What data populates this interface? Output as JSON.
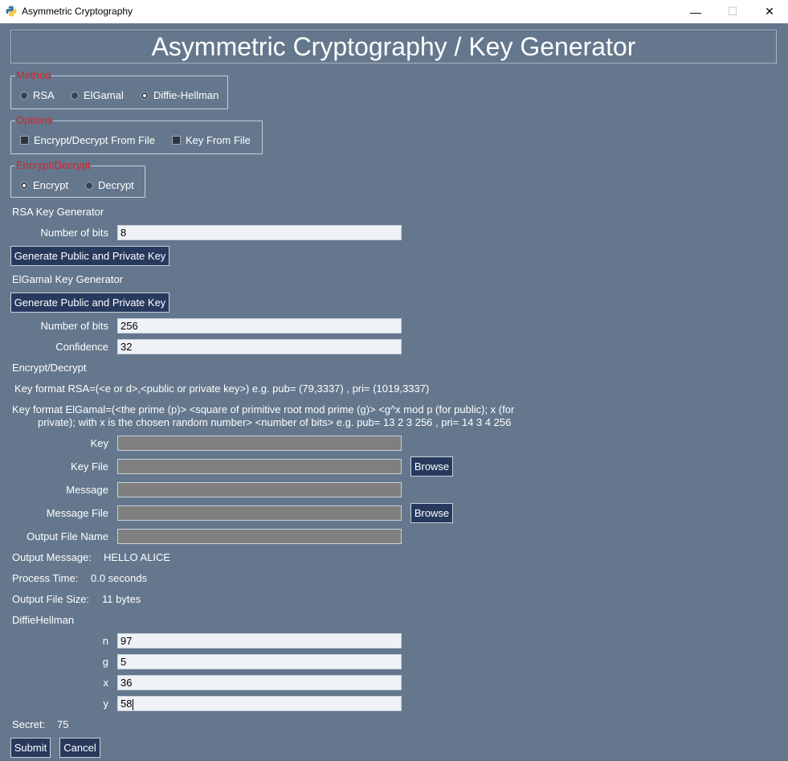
{
  "window": {
    "title": "Asymmetric Cryptography",
    "controls": {
      "minimize": "—",
      "maximize": "☐",
      "close": "✕"
    }
  },
  "header": {
    "title": "Asymmetric Cryptography / Key Generator"
  },
  "method": {
    "legend": "Method",
    "options": [
      "RSA",
      "ElGamal",
      "Diffie-Hellman"
    ],
    "selected": "Diffie-Hellman"
  },
  "options": {
    "legend": "Options",
    "encrypt_from_file": "Encrypt/Decrypt From File",
    "key_from_file": "Key From File"
  },
  "mode": {
    "legend": "Encrypt/Decrypt",
    "options": [
      "Encrypt",
      "Decrypt"
    ],
    "selected": "Encrypt"
  },
  "rsa": {
    "heading": "RSA Key Generator",
    "bits_label": "Number of bits",
    "bits_value": "8",
    "generate_label": "Generate Public and Private Key"
  },
  "elgamal": {
    "heading": "ElGamal Key Generator",
    "generate_label": "Generate Public and Private Key",
    "bits_label": "Number of bits",
    "bits_value": "256",
    "confidence_label": "Confidence",
    "confidence_value": "32"
  },
  "encdec": {
    "heading": "Encrypt/Decrypt",
    "rsa_format": "Key format RSA=(<e or d>,<public or private key>) e.g. pub= (79,3337) , pri= (1019,3337)",
    "elgamal_format_line1": "Key format ElGamal=(<the prime (p)> <square of primitive root mod prime (g)> <g^x mod p (for public); x (for",
    "elgamal_format_line2": "private); with x is the chosen random number> <number of bits> e.g. pub= 13 2 3 256 , pri= 14 3 4 256",
    "key_label": "Key",
    "key_file_label": "Key File",
    "message_label": "Message",
    "message_file_label": "Message File",
    "output_file_label": "Output File Name",
    "browse_label": "Browse",
    "output_message_label": "Output Message:",
    "output_message_value": "HELLO ALICE",
    "process_time_label": "Process Time:",
    "process_time_value": "0.0 seconds",
    "output_size_label": "Output File Size:",
    "output_size_value": "11 bytes"
  },
  "dh": {
    "heading": "DiffieHellman",
    "n_label": "n",
    "n_value": "97",
    "g_label": "g",
    "g_value": "5",
    "x_label": "x",
    "x_value": "36",
    "y_label": "y",
    "y_value": "58",
    "secret_label": "Secret:",
    "secret_value": "75"
  },
  "actions": {
    "submit": "Submit",
    "cancel": "Cancel"
  },
  "colors": {
    "background": "#64778d",
    "legend": "#d8232a",
    "button": "#273a5e",
    "entry": "#eef1f6",
    "entry_disabled": "#7f7f7f"
  }
}
